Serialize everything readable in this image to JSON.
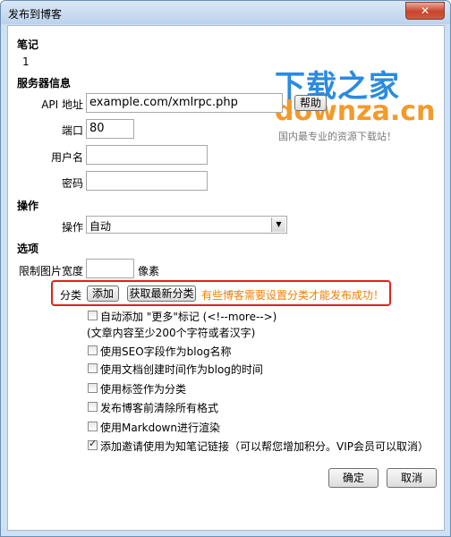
{
  "window": {
    "title": "发布到博客",
    "close_glyph": "✕"
  },
  "note": {
    "heading": "笔记",
    "value": "1"
  },
  "server": {
    "heading": "服务器信息",
    "api_label": "API 地址",
    "api_value": "example.com/xmlrpc.php",
    "help_button": "帮助",
    "port_label": "端口",
    "port_value": "80",
    "username_label": "用户名",
    "username_value": "",
    "password_label": "密码",
    "password_value": ""
  },
  "operation": {
    "heading": "操作",
    "label": "操作",
    "selected": "自动",
    "arrow_icon": "▼"
  },
  "options": {
    "heading": "选项",
    "image_width_label": "限制图片宽度",
    "image_width_value": "",
    "image_width_unit": "像素",
    "category_label": "分类",
    "add_button": "添加",
    "fetch_button": "获取最新分类",
    "category_warning": "有些博客需要设置分类才能发布成功！",
    "checkboxes": [
      {
        "label": "自动添加 \"更多\"标记 (<!--more-->)",
        "checked": false
      },
      {
        "label": "使用SEO字段作为blog名称",
        "checked": false
      },
      {
        "label": "使用文档创建时间作为blog的时间",
        "checked": false
      },
      {
        "label": "使用标签作为分类",
        "checked": false
      },
      {
        "label": "发布博客前清除所有格式",
        "checked": false
      },
      {
        "label": "使用Markdown进行渲染",
        "checked": false
      },
      {
        "label": "添加邀请使用为知笔记链接（可以帮您增加积分。VIP会员可以取消）",
        "checked": true
      }
    ],
    "more_note": "(文章内容至少200个字符或者汉字)"
  },
  "buttons": {
    "ok": "确定",
    "cancel": "取消"
  },
  "watermark": {
    "brand": "下载之家",
    "url": "downza.cn",
    "tagline": "国内最专业的资源下载站！"
  }
}
